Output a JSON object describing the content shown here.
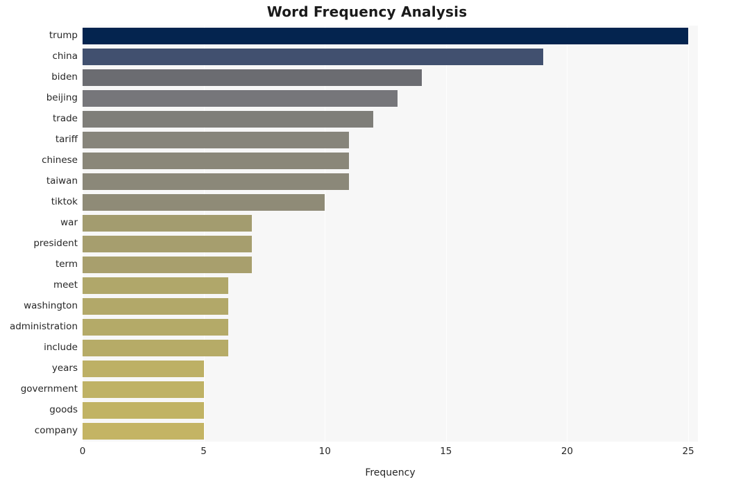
{
  "chart_data": {
    "type": "bar",
    "orientation": "horizontal",
    "title": "Word Frequency Analysis",
    "xlabel": "Frequency",
    "ylabel": "",
    "categories": [
      "trump",
      "china",
      "biden",
      "beijing",
      "trade",
      "tariff",
      "chinese",
      "taiwan",
      "tiktok",
      "war",
      "president",
      "term",
      "meet",
      "washington",
      "administration",
      "include",
      "years",
      "government",
      "goods",
      "company"
    ],
    "values": [
      25,
      19,
      14,
      13,
      12,
      11,
      11,
      11,
      10,
      7,
      7,
      7,
      6,
      6,
      6,
      6,
      5,
      5,
      5,
      5
    ],
    "bar_colors": [
      "#04244f",
      "#41506f",
      "#6b6c71",
      "#76767a",
      "#7f7e79",
      "#87857b",
      "#8a8779",
      "#8b8879",
      "#8f8b77",
      "#a39c6f",
      "#a69e6e",
      "#a89f6d",
      "#b0a76a",
      "#b2a869",
      "#b4aa68",
      "#b6ab67",
      "#bdb065",
      "#bfb265",
      "#c1b364",
      "#c4b464"
    ],
    "xlim": [
      0,
      25.4
    ],
    "xticks": [
      0,
      5,
      10,
      15,
      20,
      25
    ],
    "xtick_labels": [
      "0",
      "5",
      "10",
      "15",
      "20",
      "25"
    ],
    "grid": true,
    "grid_axis": "x",
    "grid_color": "#ffffff",
    "legend": false,
    "plot_background": "#f7f7f7",
    "figure_background": "#ffffff",
    "title_color": "#1a1a1a",
    "tick_label_color": "#262626"
  }
}
